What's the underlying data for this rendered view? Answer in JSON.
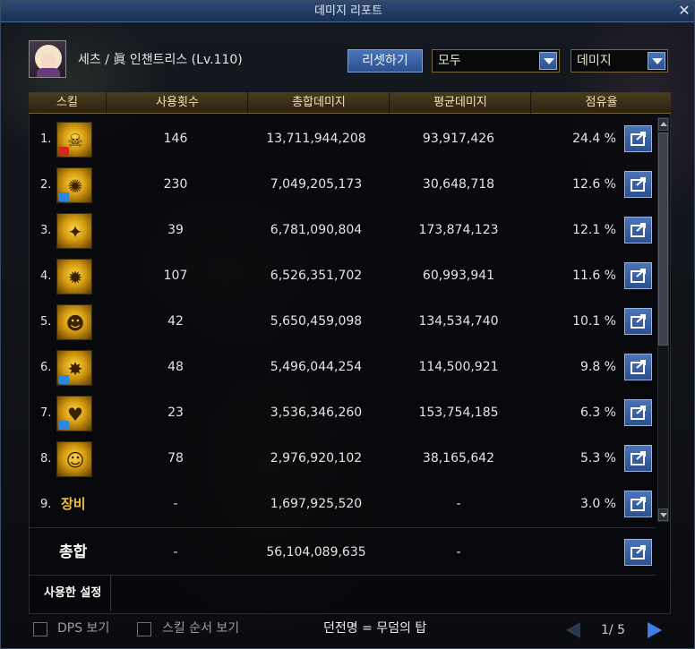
{
  "window": {
    "title": "데미지 리포트"
  },
  "character": {
    "name": "세츠 / 眞 인챈트리스 (Lv.110)"
  },
  "toolbar": {
    "reset_label": "리셋하기",
    "filter_value": "모두",
    "sort_value": "데미지"
  },
  "table": {
    "headers": [
      "스킬",
      "사용횟수",
      "총합데미지",
      "평균데미지",
      "점유율"
    ],
    "rows": [
      {
        "rank": "1.",
        "icon": "skill-icon-1",
        "uses": "146",
        "total": "13,711,944,208",
        "avg": "93,917,426",
        "share": "24.4 %"
      },
      {
        "rank": "2.",
        "icon": "skill-icon-2",
        "uses": "230",
        "total": "7,049,205,173",
        "avg": "30,648,718",
        "share": "12.6 %"
      },
      {
        "rank": "3.",
        "icon": "skill-icon-3",
        "uses": "39",
        "total": "6,781,090,804",
        "avg": "173,874,123",
        "share": "12.1 %"
      },
      {
        "rank": "4.",
        "icon": "skill-icon-4",
        "uses": "107",
        "total": "6,526,351,702",
        "avg": "60,993,941",
        "share": "11.6 %"
      },
      {
        "rank": "5.",
        "icon": "skill-icon-5",
        "uses": "42",
        "total": "5,650,459,098",
        "avg": "134,534,740",
        "share": "10.1 %"
      },
      {
        "rank": "6.",
        "icon": "skill-icon-6",
        "uses": "48",
        "total": "5,496,044,254",
        "avg": "114,500,921",
        "share": "9.8 %"
      },
      {
        "rank": "7.",
        "icon": "skill-icon-7",
        "uses": "23",
        "total": "3,536,346,260",
        "avg": "153,754,185",
        "share": "6.3 %"
      },
      {
        "rank": "8.",
        "icon": "skill-icon-8",
        "uses": "78",
        "total": "2,976,920,102",
        "avg": "38,165,642",
        "share": "5.3 %"
      },
      {
        "rank": "9.",
        "equip_label": "장비",
        "uses": "-",
        "total": "1,697,925,520",
        "avg": "-",
        "share": "3.0 %"
      }
    ],
    "total": {
      "label": "총합",
      "uses": "-",
      "total": "56,104,089,635",
      "avg": "-"
    }
  },
  "settings": {
    "label": "사용한 설정"
  },
  "bottom": {
    "dps_label": "DPS 보기",
    "skill_order_label": "스킬 순서 보기",
    "dungeon_info": "던전명 = 무덤의 탑",
    "page": "1/ 5"
  },
  "colors": {
    "accent_blue": "#3f7ee8",
    "header_gold": "#4a3c1e",
    "equip_label": "#f0c038"
  }
}
